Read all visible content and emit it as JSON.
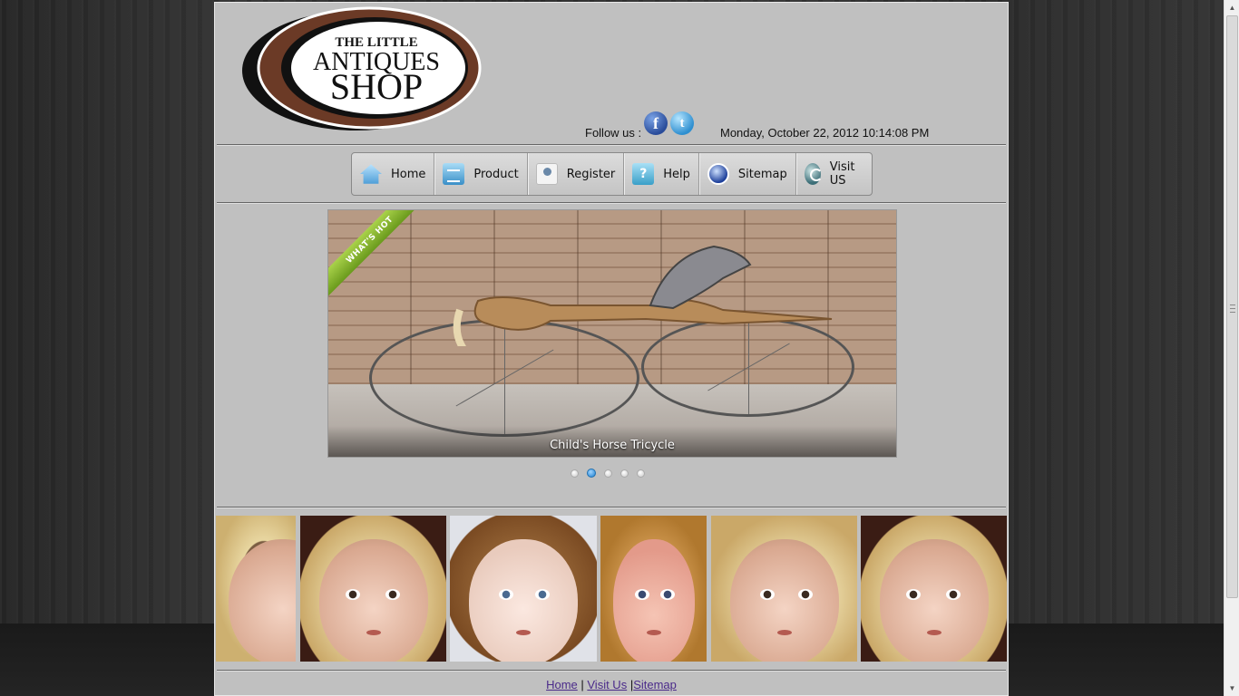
{
  "header": {
    "logo": {
      "line1": "THE LITTLE",
      "line2": "ANTIQUES",
      "line3": "SHOP"
    },
    "follow_label": "Follow us :",
    "social": [
      {
        "name": "facebook",
        "glyph": "f"
      },
      {
        "name": "twitter",
        "glyph": "t"
      }
    ],
    "datetime": "Monday, October 22, 2012 10:14:08 PM"
  },
  "nav": {
    "items": [
      {
        "label": "Home",
        "icon": "home-icon"
      },
      {
        "label": "Product",
        "icon": "product-icon"
      },
      {
        "label": "Register",
        "icon": "register-icon"
      },
      {
        "label": "Help",
        "icon": "help-icon"
      },
      {
        "label": "Sitemap",
        "icon": "sitemap-icon"
      },
      {
        "label": "Visit US",
        "icon": "visit-icon"
      }
    ]
  },
  "slider": {
    "ribbon": "WHAT'S HOT",
    "caption": "Child's Horse Tricycle",
    "dot_count": 5,
    "active_dot": 2
  },
  "gallery": {
    "items": [
      "doll-blonde-1",
      "doll-blonde-hat",
      "doll-brunette",
      "doll-flower-crown",
      "doll-blonde-2",
      "doll-blonde-hat-2"
    ]
  },
  "footer": {
    "home": "Home",
    "sep1": " | ",
    "visit": "Visit Us",
    "sep2": " |",
    "sitemap": "Sitemap"
  },
  "colors": {
    "page_bg": "#c0c0c0",
    "link": "#4a2a8a",
    "active_dot": "#1e7fd0",
    "logo_brown": "#6b3a26"
  }
}
